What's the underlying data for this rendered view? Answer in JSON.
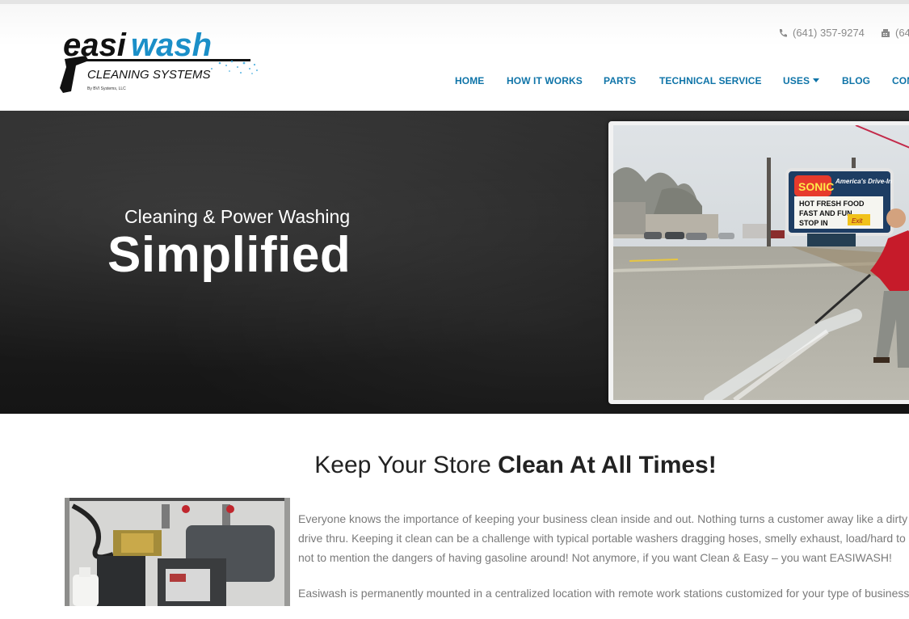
{
  "brand": {
    "logo_word_1": "easi",
    "logo_word_2": "wash",
    "logo_line_2": "CLEANING SYSTEMS",
    "logo_line_3": "By BVI Systems, LLC"
  },
  "contact": {
    "phone": "(641) 357-9274",
    "fax": "(64",
    "phone_icon": "phone-icon",
    "fax_icon": "fax-icon"
  },
  "nav": {
    "items": [
      {
        "label": "HOME"
      },
      {
        "label": "HOW IT WORKS"
      },
      {
        "label": "PARTS"
      },
      {
        "label": "TECHNICAL SERVICE"
      },
      {
        "label": "USES"
      },
      {
        "label": "BLOG"
      },
      {
        "label": "CON"
      }
    ],
    "color": "#0f74a8"
  },
  "hero": {
    "subtitle": "Cleaning & Power Washing",
    "title": "Simplified",
    "photo_sign": {
      "brand": "SONIC",
      "tagline": "America's Drive-In",
      "line1": "HOT FRESH FOOD",
      "line2": "FAST AND FUN",
      "line3": "STOP IN",
      "exit": "Exit"
    }
  },
  "section": {
    "title_light": "Keep Your Store ",
    "title_bold": "Clean At All Times!"
  },
  "body": {
    "p1_l1": "Everyone knows the importance of keeping your business clean inside and out. Nothing turns a customer away like a dirty",
    "p1_l2": "drive thru. Keeping it clean can be a challenge with typical portable washers dragging hoses, smelly exhaust, load/hard to s",
    "p1_l3": "not to mention the dangers of having gasoline around! Not anymore, if you want Clean & Easy – you want EASIWASH!",
    "p2_l1": "Easiwash is permanently mounted in a centralized location with remote work stations customized for your type of business"
  }
}
